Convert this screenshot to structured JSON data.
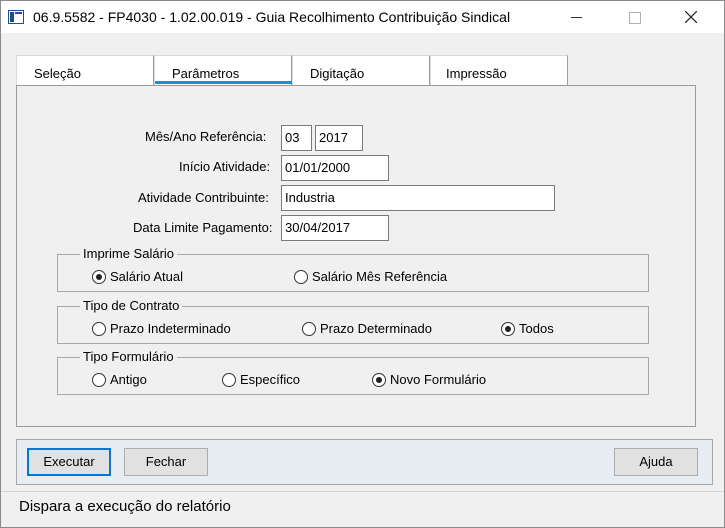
{
  "window": {
    "title": "06.9.5582 - FP4030 - 1.02.00.019 - Guia Recolhimento Contribuição Sindical"
  },
  "tabs": [
    {
      "label": "Seleção",
      "active": false
    },
    {
      "label": "Parâmetros",
      "active": true
    },
    {
      "label": "Digitação",
      "active": false
    },
    {
      "label": "Impressão",
      "active": false
    }
  ],
  "form": {
    "mes_ano_label": "Mês/Ano Referência:",
    "mes_value": "03",
    "ano_value": "2017",
    "inicio_label": "Início Atividade:",
    "inicio_value": "01/01/2000",
    "atividade_label": "Atividade Contribuinte:",
    "atividade_value": "Industria",
    "data_limite_label": "Data Limite Pagamento:",
    "data_limite_value": "30/04/2017"
  },
  "groups": {
    "imprime_salario": {
      "title": "Imprime Salário",
      "options": [
        {
          "label": "Salário Atual",
          "checked": true
        },
        {
          "label": "Salário Mês Referência",
          "checked": false
        }
      ]
    },
    "tipo_contrato": {
      "title": "Tipo de Contrato",
      "options": [
        {
          "label": "Prazo Indeterminado",
          "checked": false
        },
        {
          "label": "Prazo Determinado",
          "checked": false
        },
        {
          "label": "Todos",
          "checked": true
        }
      ]
    },
    "tipo_formulario": {
      "title": "Tipo Formulário",
      "options": [
        {
          "label": "Antigo",
          "checked": false
        },
        {
          "label": "Específico",
          "checked": false
        },
        {
          "label": "Novo Formulário",
          "checked": true
        }
      ]
    }
  },
  "buttons": {
    "executar": "Executar",
    "fechar": "Fechar",
    "ajuda": "Ajuda"
  },
  "status": {
    "text": "Dispara a execução do relatório"
  },
  "colors": {
    "tab_accent": "#1e8fd6",
    "default_button_border": "#0078d7",
    "button_bar_bg": "#e8ecf3"
  }
}
